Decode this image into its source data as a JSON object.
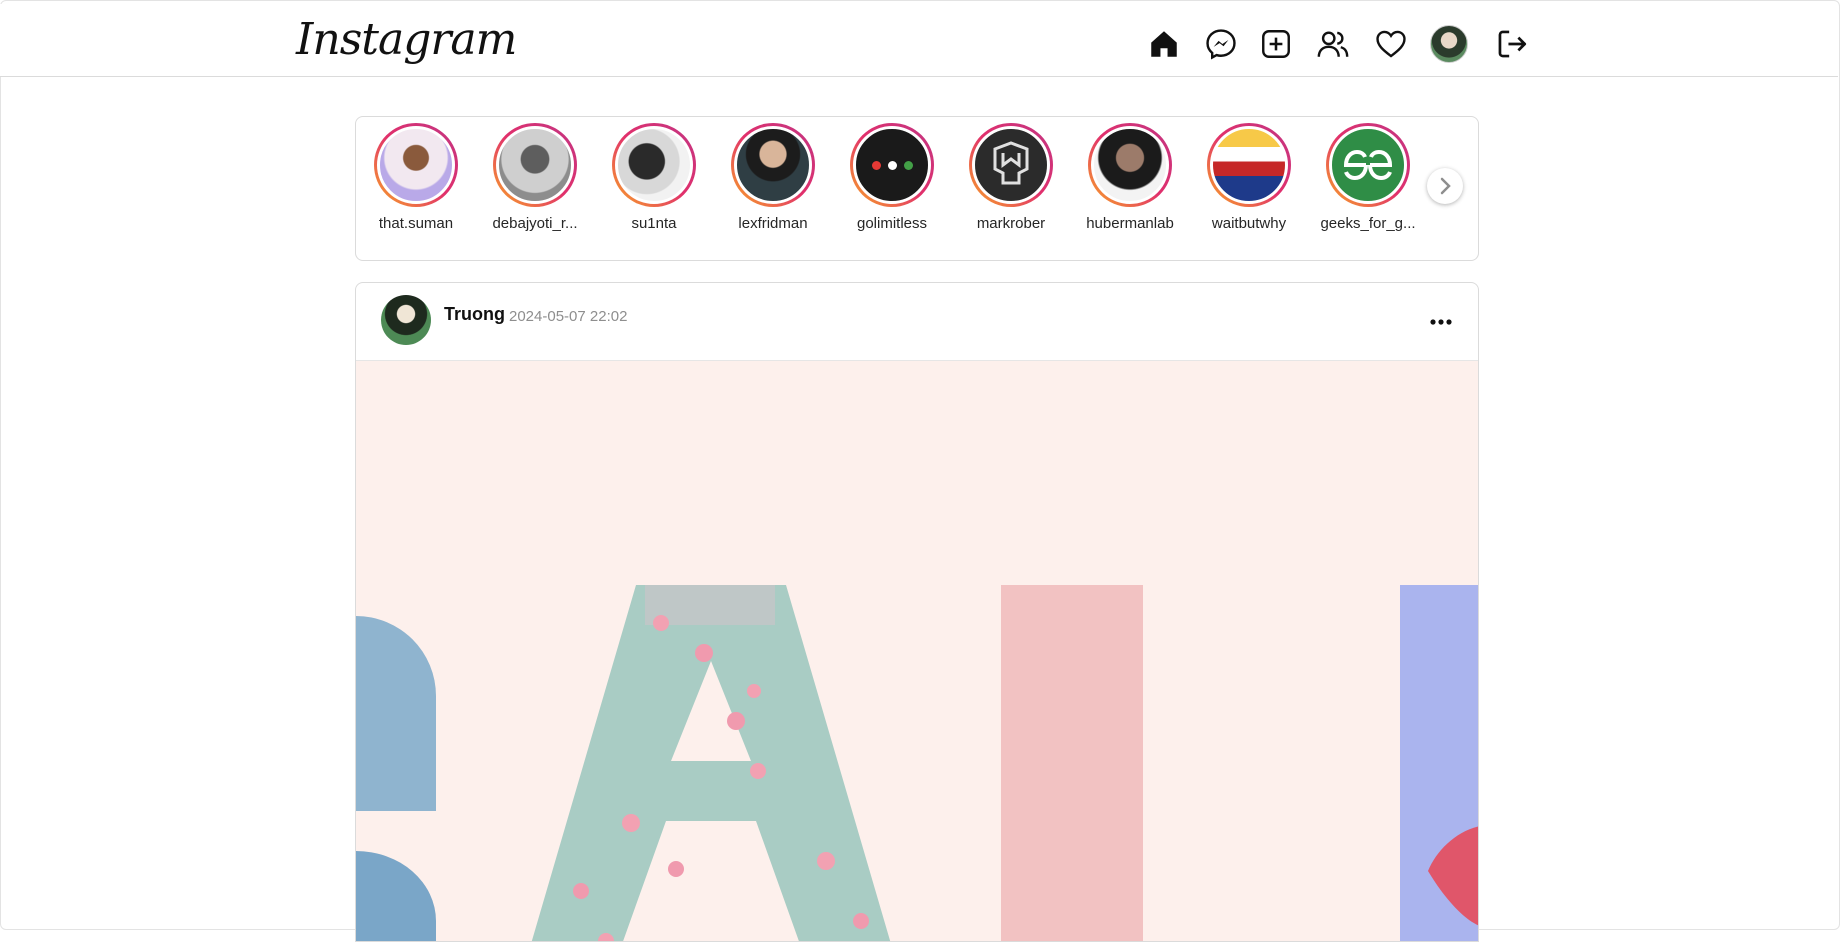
{
  "app": {
    "logo_text": "Instagram"
  },
  "nav": {
    "icons": [
      "home-icon",
      "messenger-icon",
      "create-icon",
      "people-icon",
      "heart-icon",
      "profile-avatar",
      "logout-icon"
    ]
  },
  "stories": {
    "items": [
      {
        "name": "that.suman"
      },
      {
        "name": "debajyoti_r..."
      },
      {
        "name": "su1nta"
      },
      {
        "name": "lexfridman"
      },
      {
        "name": "golimitless"
      },
      {
        "name": "markrober"
      },
      {
        "name": "hubermanlab"
      },
      {
        "name": "waitbutwhy"
      },
      {
        "name": "geeks_for_g..."
      }
    ]
  },
  "post": {
    "username": "Truong",
    "timestamp": "2024-05-07 22:02"
  },
  "colors": {
    "story_ring_start": "#f9a825",
    "story_ring_end": "#c13584",
    "image_bg": "#fdf0ec"
  }
}
